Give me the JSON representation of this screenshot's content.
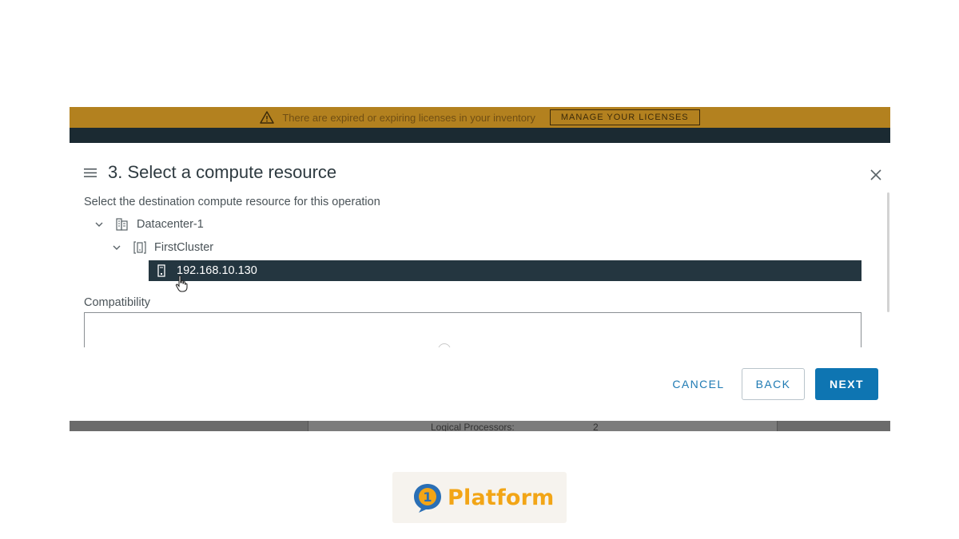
{
  "banner": {
    "message": "There are expired or expiring licenses in your inventory",
    "button_label": "MANAGE YOUR LICENSES"
  },
  "background": {
    "row_label": "Logical Processors:",
    "row_value": "2"
  },
  "modal": {
    "title": "3. Select a compute resource",
    "subtitle": "Select the destination compute resource for this operation",
    "tree": {
      "datacenter": "Datacenter-1",
      "cluster": "FirstCluster",
      "host": "192.168.10.130"
    },
    "compatibility_label": "Compatibility",
    "buttons": {
      "cancel": "CANCEL",
      "back": "BACK",
      "next": "NEXT"
    }
  },
  "logo": {
    "mark_text": "1",
    "text": "Platform"
  },
  "colors": {
    "banner": "#b3811f",
    "selected_row": "#243640",
    "primary_button": "#0e75b2",
    "logo_orange": "#f2a516",
    "logo_blue": "#2a6fb5"
  },
  "icons": [
    "warning-icon",
    "menu-icon",
    "close-icon",
    "chevron-down-icon",
    "datacenter-icon",
    "cluster-icon",
    "host-icon",
    "hand-cursor-icon"
  ]
}
